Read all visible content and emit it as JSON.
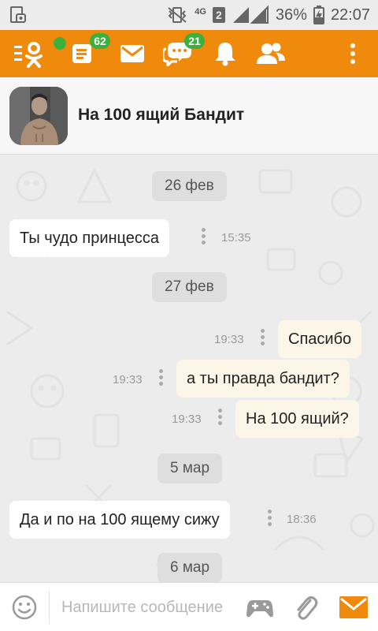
{
  "status_bar": {
    "network": "4G",
    "sim": "2",
    "battery": "36%",
    "time": "22:07"
  },
  "app_bar": {
    "notifications_badge": "62",
    "discussions_badge": "21"
  },
  "chat": {
    "title": "На 100 ящий Бандит"
  },
  "messages": [
    {
      "type": "date",
      "text": "26 фев"
    },
    {
      "type": "in",
      "text": "Ты чудо принцесса",
      "time": "15:35"
    },
    {
      "type": "date",
      "text": "27 фев"
    },
    {
      "type": "out",
      "text": "Спасибо",
      "time": "19:33"
    },
    {
      "type": "out",
      "text": "а ты правда бандит?",
      "time": "19:33"
    },
    {
      "type": "out",
      "text": "На 100 ящий?",
      "time": "19:33"
    },
    {
      "type": "date",
      "text": "5 мар"
    },
    {
      "type": "in",
      "text": "Да и по на 100 ящему сижу",
      "time": "18:36"
    },
    {
      "type": "date",
      "text": "6 мар"
    }
  ],
  "input": {
    "placeholder": "Напишите сообщение",
    "value": ""
  },
  "colors": {
    "brand": "#f08a0c",
    "badge": "#3cb03c",
    "bubble_in": "#ffffff",
    "bubble_out": "#fcf6e9",
    "background": "#ececec"
  }
}
